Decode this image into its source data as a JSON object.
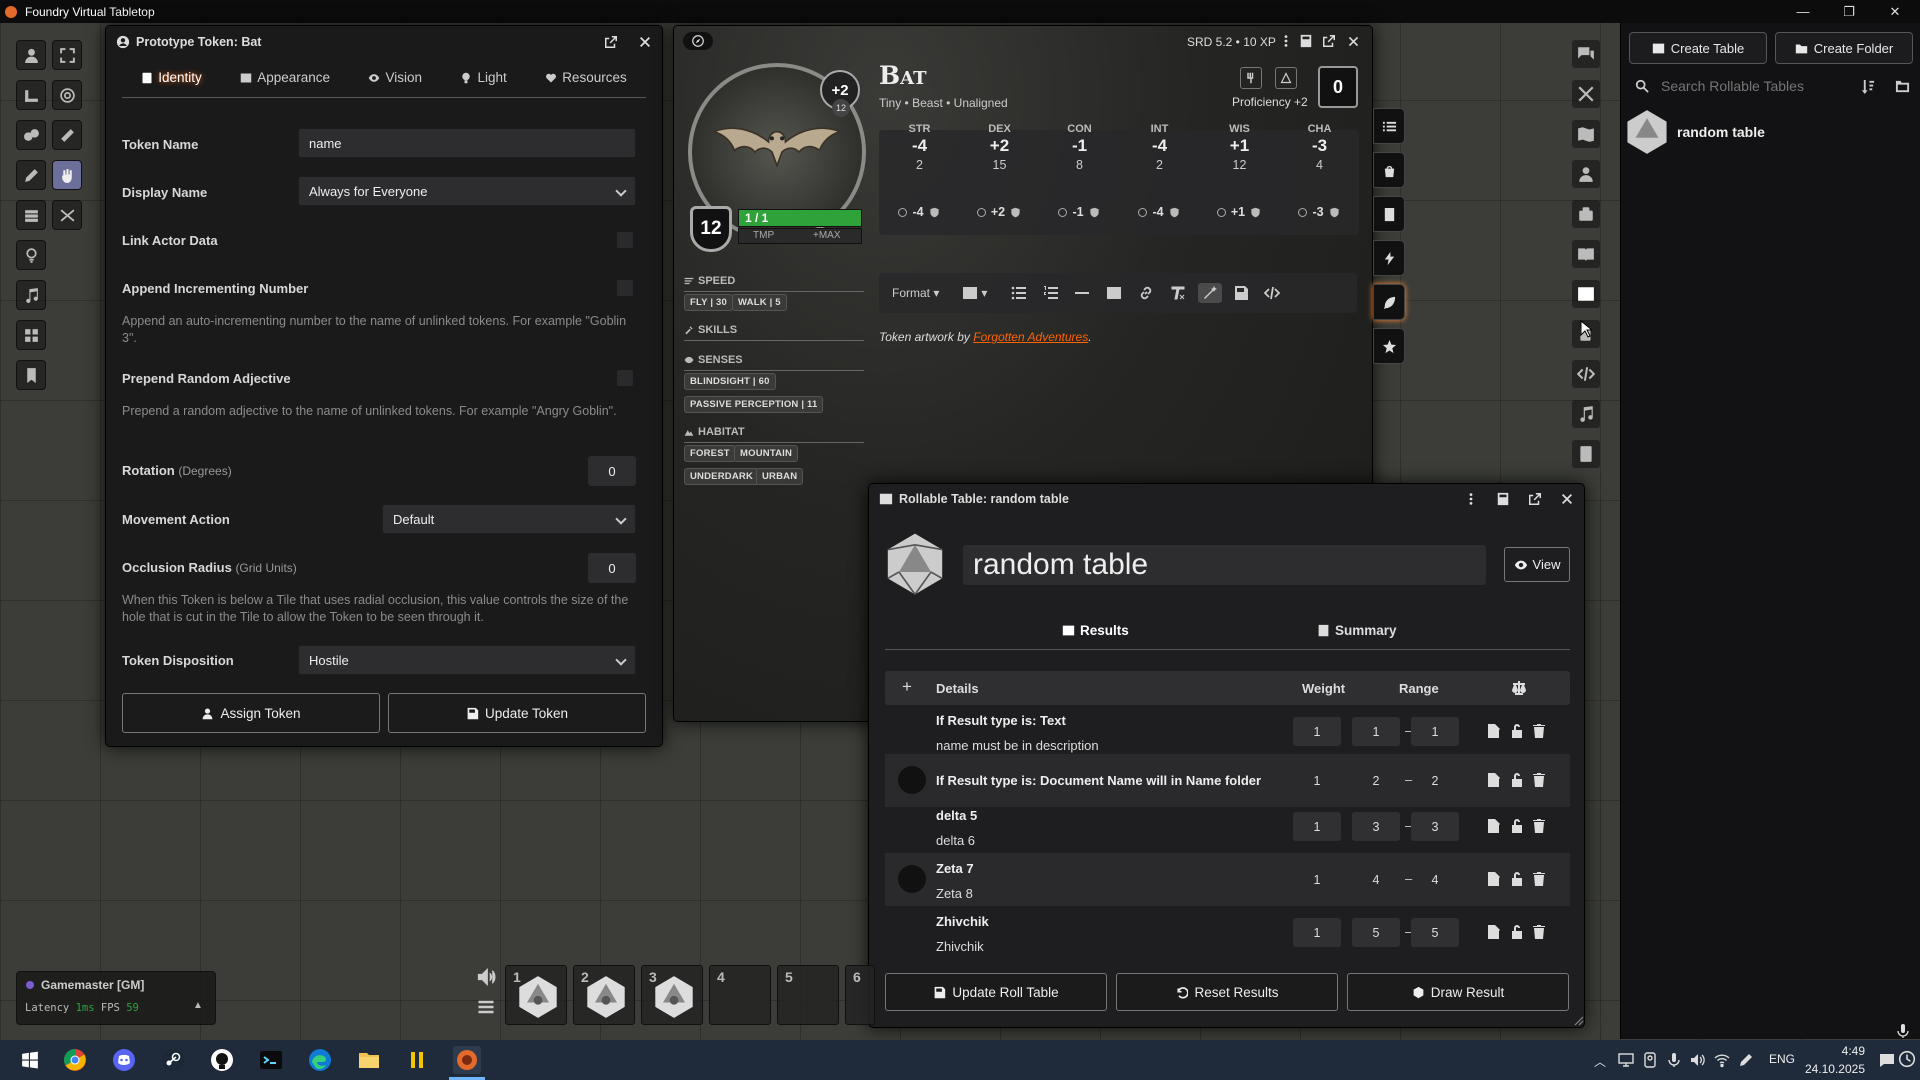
{
  "app": {
    "title": "Foundry Virtual Tabletop"
  },
  "colors": {
    "accent": "#ff6400",
    "hp_green": "#2fa33a",
    "taskbar": "#1f2a3a"
  },
  "token_config": {
    "title": "Prototype Token: Bat",
    "tabs": [
      "Identity",
      "Appearance",
      "Vision",
      "Light",
      "Resources"
    ],
    "active_tab": "Identity",
    "token_name_label": "Token Name",
    "token_name_value": "name",
    "display_name_label": "Display Name",
    "display_name_value": "Always for Everyone",
    "link_actor_label": "Link Actor Data",
    "append_label": "Append Incrementing Number",
    "append_hint": "Append an auto-incrementing number to the name of unlinked tokens. For example \"Goblin 3\".",
    "prepend_label": "Prepend Random Adjective",
    "prepend_hint": "Prepend a random adjective to the name of unlinked tokens. For example \"Angry Goblin\".",
    "rotation_label": "Rotation",
    "rotation_units": "(Degrees)",
    "rotation_value": "0",
    "movement_label": "Movement Action",
    "movement_value": "Default",
    "occlusion_label": "Occlusion Radius",
    "occlusion_units": "(Grid Units)",
    "occlusion_value": "0",
    "occlusion_hint": "When this Token is below a Tile that uses radial occlusion, this value controls the size of the hole that is cut in the Tile to allow the Token to be seen through it.",
    "disposition_label": "Token Disposition",
    "disposition_value": "Hostile",
    "assign_button": "Assign Token",
    "update_button": "Update Token"
  },
  "actor": {
    "name": "Bat",
    "subtitle": "Tiny • Beast • Unaligned",
    "srd": "SRD 5.2 • 10 XP",
    "proficiency": "Proficiency +2",
    "cr_badge": "+2",
    "cr_small": "12",
    "ac": "12",
    "hp": "1 / 1",
    "tmp": "TMP",
    "max": "+MAX",
    "inspiration": "0",
    "abilities": [
      {
        "name": "STR",
        "mod": "-4",
        "val": "2",
        "save": "-4"
      },
      {
        "name": "DEX",
        "mod": "+2",
        "val": "15",
        "save": "+2"
      },
      {
        "name": "CON",
        "mod": "-1",
        "val": "8",
        "save": "-1"
      },
      {
        "name": "INT",
        "mod": "-4",
        "val": "2",
        "save": "-4"
      },
      {
        "name": "WIS",
        "mod": "+1",
        "val": "12",
        "save": "+1"
      },
      {
        "name": "CHA",
        "mod": "-3",
        "val": "4",
        "save": "-3"
      }
    ],
    "speed_label": "SPEED",
    "speed_fly": "FLY | 30",
    "speed_walk": "WALK | 5",
    "skills_label": "SKILLS",
    "senses_label": "SENSES",
    "sense_blindsight": "BLINDSIGHT | 60",
    "sense_passive": "PASSIVE PERCEPTION | 11",
    "habitat_label": "HABITAT",
    "habitats": [
      "FOREST",
      "MOUNTAIN",
      "UNDERDARK",
      "URBAN"
    ],
    "format_label": "Format",
    "artwork_prefix": "Token artwork by ",
    "artwork_link": "Forgotten Adventures",
    "artwork_suffix": "."
  },
  "roll_table": {
    "title": "Rollable Table: random table",
    "name": "random table",
    "view_button": "View",
    "tab_results": "Results",
    "tab_summary": "Summary",
    "col_details": "Details",
    "col_weight": "Weight",
    "col_range": "Range",
    "rows": [
      {
        "name": "If Result type is: Text",
        "desc": "name must be in description",
        "weight": "1",
        "from": "1",
        "to": "1"
      },
      {
        "name": "If Result type is: Document Name will in Name folder",
        "desc": "",
        "weight": "1",
        "from": "2",
        "to": "2"
      },
      {
        "name": "delta 5",
        "desc": "delta 6",
        "weight": "1",
        "from": "3",
        "to": "3"
      },
      {
        "name": "Zeta 7",
        "desc": "Zeta 8",
        "weight": "1",
        "from": "4",
        "to": "4"
      },
      {
        "name": "Zhivchik",
        "desc": "Zhivchik",
        "weight": "1",
        "from": "5",
        "to": "5"
      }
    ],
    "update_button": "Update Roll Table",
    "reset_button": "Reset Results",
    "draw_button": "Draw Result"
  },
  "sidebar": {
    "create_table": "Create Table",
    "create_folder": "Create Folder",
    "search_placeholder": "Search Rollable Tables",
    "entries": [
      "random table"
    ]
  },
  "players": {
    "user": "Gamemaster [GM]",
    "latency_label": "Latency",
    "latency": "1ms",
    "fps_label": "FPS",
    "fps": "59"
  },
  "hotbar": {
    "slots": [
      "1",
      "2",
      "3",
      "4",
      "5",
      "6"
    ]
  },
  "taskbar": {
    "language": "ENG",
    "time": "4:49",
    "date": "24.10.2025"
  }
}
